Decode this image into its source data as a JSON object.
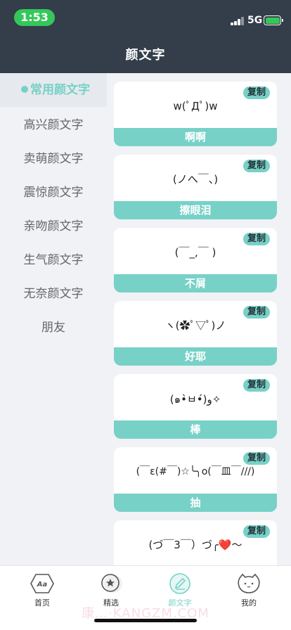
{
  "status_bar": {
    "time": "1:53",
    "network": "5G"
  },
  "header": {
    "title": "颜文字"
  },
  "sidebar": {
    "items": [
      {
        "label": "常用颜文字",
        "active": true
      },
      {
        "label": "高兴颜文字",
        "active": false
      },
      {
        "label": "卖萌颜文字",
        "active": false
      },
      {
        "label": "震惊颜文字",
        "active": false
      },
      {
        "label": "亲吻颜文字",
        "active": false
      },
      {
        "label": "生气颜文字",
        "active": false
      },
      {
        "label": "无奈颜文字",
        "active": false
      },
      {
        "label": "朋友",
        "active": false
      }
    ]
  },
  "copy_label": "复制",
  "cards": [
    {
      "emoticon": "w(ﾟДﾟ)w",
      "name": "啊啊"
    },
    {
      "emoticon": "(ノへ￣、)",
      "name": "擦眼泪"
    },
    {
      "emoticon": "(￣_,￣ )",
      "name": "不屑"
    },
    {
      "emoticon": "ヽ(✿ﾟ▽ﾟ)ノ",
      "name": "好耶"
    },
    {
      "emoticon": "(๑•̀ㅂ•́)و✧",
      "name": "棒"
    },
    {
      "emoticon": "(￣ε(#￣)☆╰╮o(￣皿￣///)",
      "name": "抽"
    },
    {
      "emoticon": "(づ￣3￣）づ╭❤️～",
      "name": ""
    }
  ],
  "tabbar": {
    "items": [
      {
        "label": "首页",
        "icon": "home-aa-icon"
      },
      {
        "label": "精选",
        "icon": "star-badge-icon"
      },
      {
        "label": "颜文字",
        "icon": "pencil-icon",
        "active": true
      },
      {
        "label": "我的",
        "icon": "cat-face-icon"
      }
    ]
  },
  "watermark": "康…·KANGZM.COM",
  "colors": {
    "accent": "#77d1c7",
    "header": "#333e4a",
    "status_pill": "#35c759"
  }
}
